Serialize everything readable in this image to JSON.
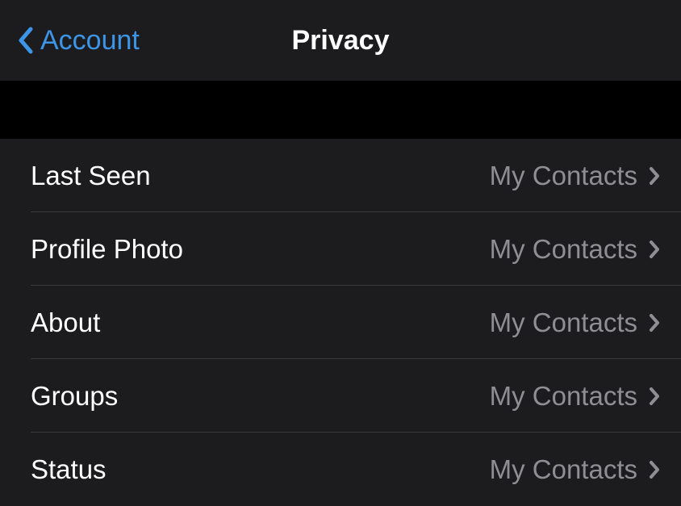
{
  "header": {
    "back_label": "Account",
    "title": "Privacy"
  },
  "settings": [
    {
      "label": "Last Seen",
      "value": "My Contacts",
      "name": "row-last-seen"
    },
    {
      "label": "Profile Photo",
      "value": "My Contacts",
      "name": "row-profile-photo"
    },
    {
      "label": "About",
      "value": "My Contacts",
      "name": "row-about"
    },
    {
      "label": "Groups",
      "value": "My Contacts",
      "name": "row-groups"
    },
    {
      "label": "Status",
      "value": "My Contacts",
      "name": "row-status"
    }
  ]
}
